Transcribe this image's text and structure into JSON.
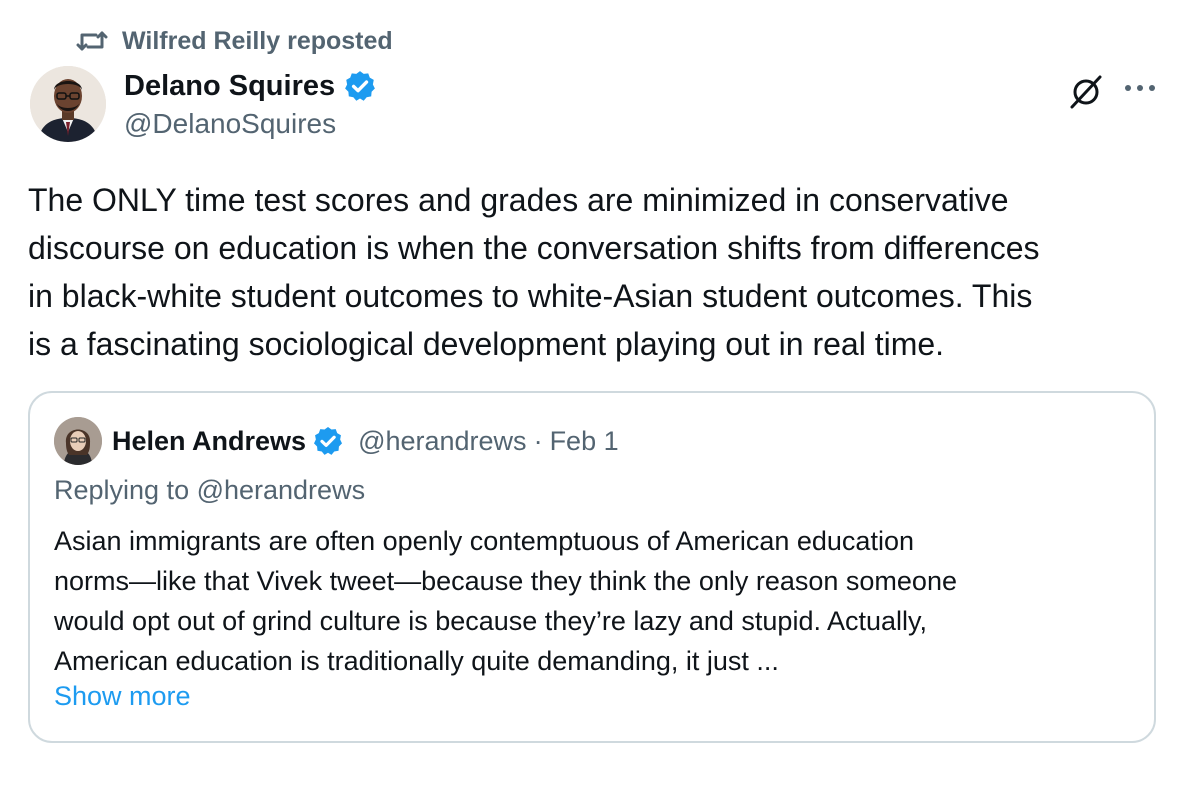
{
  "repost": {
    "text": "Wilfred Reilly reposted",
    "icon": "repost-icon"
  },
  "author": {
    "name": "Delano Squires",
    "handle": "@DelanoSquires",
    "verified": true
  },
  "tweet": {
    "text": "The ONLY time test scores and grades are minimized in conservative\ndiscourse on education is when the conversation shifts from differences\nin black-white student outcomes to white-Asian student outcomes. This\nis a fascinating sociological development playing out in real time."
  },
  "quote": {
    "name": "Helen Andrews",
    "verified": true,
    "handle": "@herandrews",
    "separator": "·",
    "date": "Feb 1",
    "replying_to": "Replying to @herandrews",
    "text": "Asian immigrants are often openly contemptuous of American education\nnorms—like that Vivek tweet—because they think the only reason someone\nwould opt out of grind culture is because they’re lazy and stupid. Actually,\nAmerican education is traditionally quite demanding, it just ...",
    "show_more": "Show more"
  },
  "icons": {
    "verified": "verified-badge-icon",
    "grok": "grok-icon",
    "more": "more-options-icon"
  },
  "colors": {
    "text_primary": "#0f1419",
    "text_secondary": "#536471",
    "accent": "#1d9bf0",
    "border": "#cfd9de"
  }
}
